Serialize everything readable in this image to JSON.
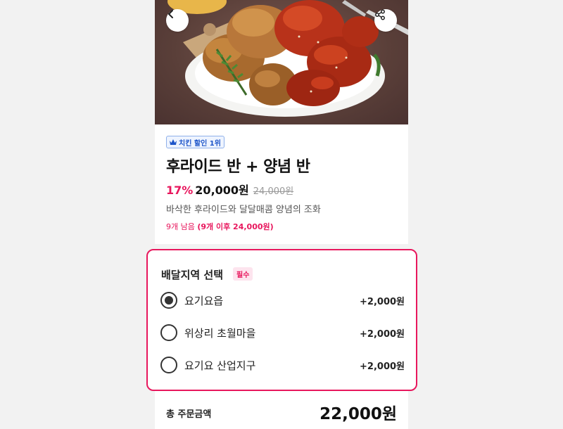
{
  "colors": {
    "accent": "#e8175d",
    "badge_blue": "#1d55c9"
  },
  "header": {
    "back_icon": "chevron-left-icon",
    "share_icon": "share-icon"
  },
  "product": {
    "badge_icon": "crown-icon",
    "badge_label": "치킨 할인 1위",
    "title": "후라이드 반 + 양념 반",
    "discount": "17%",
    "price": "20,000원",
    "original_price": "24,000원",
    "description": "바삭한 후라이드와 달달매콤 양념의 조화",
    "stock_prefix": "9개 남음",
    "stock_note": "(9개 이후 24,000원)"
  },
  "delivery": {
    "title": "배달지역 선택",
    "required_label": "필수",
    "options": [
      {
        "label": "요기요읍",
        "price": "+2,000원",
        "selected": true
      },
      {
        "label": "위상리 초월마을",
        "price": "+2,000원",
        "selected": false
      },
      {
        "label": "요기요 산업지구",
        "price": "+2,000원",
        "selected": false
      }
    ]
  },
  "total": {
    "label": "총 주문금액",
    "value": "22,000원"
  }
}
